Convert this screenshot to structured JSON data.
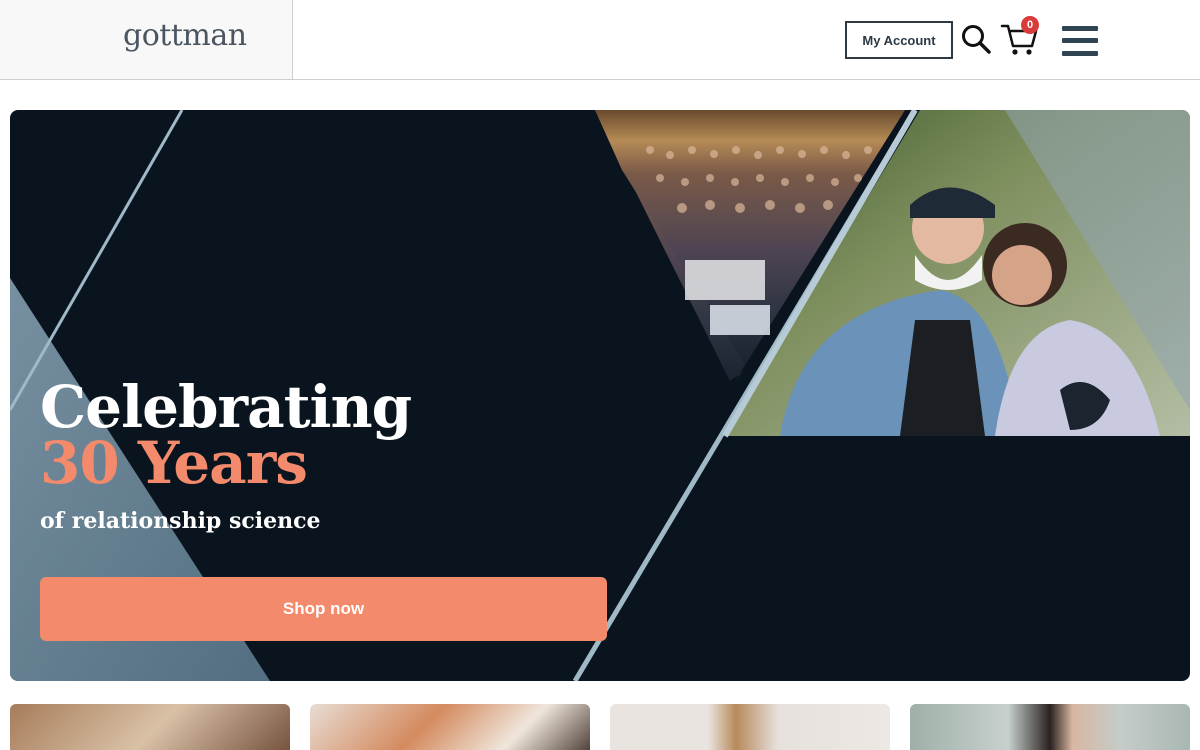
{
  "header": {
    "logo_text": "gottman",
    "account_label": "My Account",
    "cart_count": "0",
    "icons": [
      "search-icon",
      "cart-icon",
      "hamburger-menu-icon"
    ]
  },
  "hero": {
    "title_line1": "Celebrating",
    "title_line2": "30 Years",
    "subtitle": "of relationship science",
    "cta_label": "Shop now",
    "images": [
      "conference-crowd-photo",
      "couple-photo"
    ]
  },
  "cards": [
    {
      "image": "couple-hug-photo"
    },
    {
      "image": "family-baby-photo"
    },
    {
      "image": "child-curly-hair-photo"
    },
    {
      "image": "woman-portrait-photo"
    }
  ],
  "colors": {
    "accent": "#f28a6b",
    "navy": "#0a141f",
    "steel": "#8aa6b8",
    "text_dark": "#2c3a46"
  }
}
